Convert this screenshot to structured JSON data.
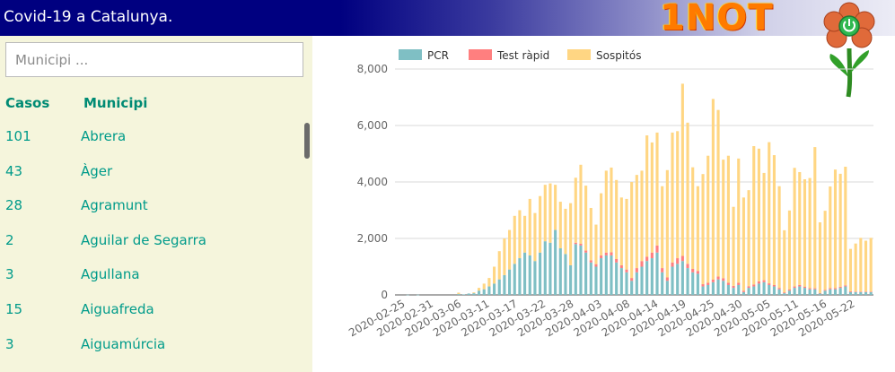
{
  "header": {
    "title": "Covid-19 a Catalunya.",
    "logo_text": "1NOT",
    "logo_icon": "flower-power-icon"
  },
  "sidebar": {
    "search_placeholder": "Municipi ...",
    "columns": {
      "cases": "Casos",
      "municipality": "Municipi"
    },
    "rows": [
      {
        "cases": "101",
        "name": "Abrera"
      },
      {
        "cases": "43",
        "name": "Àger"
      },
      {
        "cases": "28",
        "name": "Agramunt"
      },
      {
        "cases": "2",
        "name": "Aguilar de Segarra"
      },
      {
        "cases": "3",
        "name": "Agullana"
      },
      {
        "cases": "15",
        "name": "Aiguafreda"
      },
      {
        "cases": "3",
        "name": "Aiguamúrcia"
      }
    ]
  },
  "colors": {
    "header_bg": "#000080",
    "sidebar_bg": "#f5f5dc",
    "accent_text": "#009b8a",
    "pcr": "#7fbfc4",
    "test_rapid": "#ff7f7f",
    "sospitos": "#ffd683"
  },
  "chart_data": {
    "type": "bar",
    "stacked": true,
    "legend_position": "top",
    "grid": true,
    "ylim": [
      0,
      8000
    ],
    "yticks": [
      "0",
      "2,000",
      "4,000",
      "6,000",
      "8,000"
    ],
    "x_start": "2020-02-25",
    "x_tick_labels": [
      "2020-02-25",
      "2020-02-31",
      "2020-03-06",
      "2020-03-11",
      "2020-03-17",
      "2020-03-22",
      "2020-03-28",
      "2020-04-03",
      "2020-04-08",
      "2020-04-14",
      "2020-04-19",
      "2020-04-25",
      "2020-04-30",
      "2020-05-05",
      "2020-05-11",
      "2020-05-16",
      "2020-05-22"
    ],
    "series": [
      {
        "name": "PCR",
        "color": "#7fbfc4",
        "values": [
          0,
          0,
          5,
          0,
          5,
          0,
          0,
          0,
          0,
          0,
          0,
          0,
          30,
          20,
          50,
          60,
          150,
          200,
          300,
          400,
          550,
          700,
          900,
          1100,
          1300,
          1500,
          1400,
          1200,
          1500,
          1900,
          1850,
          2300,
          1650,
          1450,
          1050,
          1800,
          1750,
          1500,
          1150,
          1000,
          1300,
          1400,
          1400,
          1150,
          950,
          800,
          500,
          800,
          1000,
          1200,
          1300,
          1500,
          800,
          500,
          1000,
          1100,
          1200,
          950,
          800,
          750,
          300,
          350,
          450,
          550,
          500,
          350,
          250,
          350,
          100,
          250,
          300,
          400,
          450,
          350,
          300,
          200,
          60,
          150,
          250,
          300,
          250,
          200,
          200,
          50,
          150,
          200,
          200,
          250,
          300,
          100,
          100,
          100,
          100,
          100
        ]
      },
      {
        "name": "Test ràpid",
        "color": "#ff7f7f",
        "values": [
          0,
          0,
          0,
          0,
          0,
          0,
          0,
          0,
          0,
          0,
          0,
          0,
          0,
          0,
          0,
          0,
          0,
          0,
          0,
          0,
          0,
          0,
          0,
          0,
          0,
          0,
          0,
          0,
          0,
          0,
          0,
          0,
          0,
          0,
          0,
          50,
          60,
          70,
          80,
          90,
          100,
          100,
          110,
          120,
          100,
          100,
          100,
          150,
          200,
          150,
          200,
          250,
          150,
          120,
          150,
          200,
          180,
          150,
          120,
          100,
          80,
          80,
          90,
          100,
          90,
          80,
          70,
          80,
          50,
          60,
          70,
          80,
          70,
          60,
          50,
          50,
          30,
          40,
          50,
          50,
          45,
          40,
          35,
          20,
          30,
          40,
          40,
          40,
          40,
          30,
          20,
          20,
          20,
          20
        ]
      },
      {
        "name": "Sospitós",
        "color": "#ffd683",
        "values": [
          0,
          0,
          0,
          0,
          0,
          0,
          0,
          0,
          0,
          0,
          0,
          0,
          50,
          0,
          0,
          30,
          100,
          200,
          300,
          600,
          1000,
          1300,
          1400,
          1700,
          1700,
          1300,
          2000,
          1700,
          2000,
          2000,
          2100,
          1600,
          1650,
          1600,
          2200,
          2300,
          2800,
          2300,
          1850,
          1400,
          2200,
          2900,
          3000,
          2800,
          2400,
          2500,
          3400,
          3300,
          3200,
          4300,
          3900,
          4000,
          2900,
          3800,
          4600,
          4500,
          6100,
          5000,
          3600,
          3000,
          3900,
          4500,
          6400,
          5900,
          4200,
          4500,
          2800,
          4400,
          3300,
          3400,
          4900,
          4700,
          3800,
          5000,
          4600,
          3600,
          2200,
          2800,
          4200,
          4000,
          3800,
          3900,
          5000,
          2500,
          2800,
          3600,
          4200,
          4000,
          4200,
          1500,
          1700,
          1900,
          1800,
          1900
        ]
      }
    ]
  }
}
